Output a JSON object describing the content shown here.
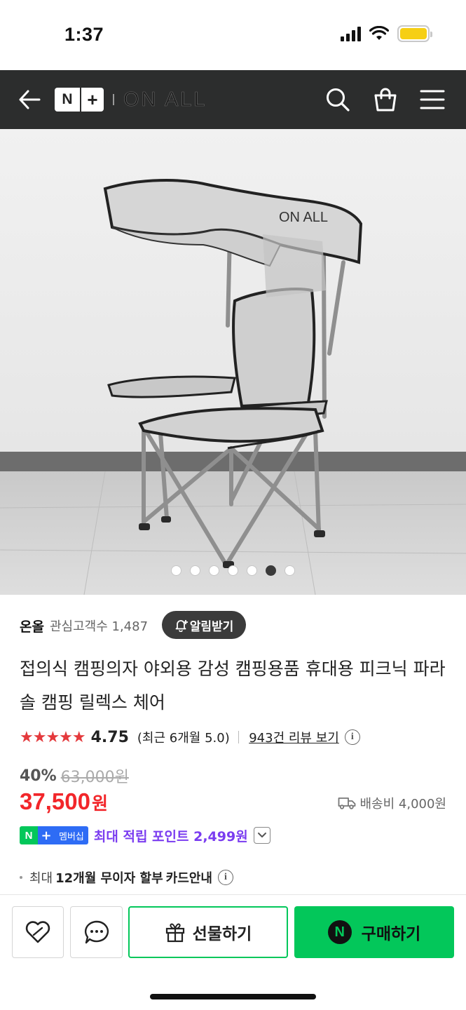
{
  "status_bar": {
    "time": "1:37"
  },
  "header": {
    "nplus_n": "N",
    "nplus_plus": "+",
    "brand": "ON ALL",
    "icons": [
      "back-arrow-icon",
      "search-icon",
      "shopping-bag-icon",
      "menu-icon"
    ]
  },
  "gallery": {
    "total": 7,
    "current": 6
  },
  "store": {
    "name": "온올",
    "followers": "관심고객수 1,487",
    "alarm_label": "알림받기"
  },
  "product": {
    "title": "접의식 캠핑의자 야외용 감성 캠핑용품 휴대용 피크닉 파라솔 캠핑 릴렉스 체어",
    "stars": "★★★★★",
    "rating": "4.75",
    "recent_rating": "(최근 6개월 5.0)",
    "review_link": "943건 리뷰 보기",
    "discount": "40%",
    "original_price": "63,000원",
    "price": "37,500",
    "currency": "원",
    "shipping": "배송비 4,000원",
    "member_badge_n": "N",
    "member_badge_plus": "+",
    "member_badge_text": "멤버십",
    "points": "최대 적립 포인트 2,499원",
    "installment_prefix": "최대",
    "installment_bold": "12개월 무이자 할부",
    "installment_suffix": "카드안내"
  },
  "bottom_bar": {
    "gift_label": "선물하기",
    "buy_label": "구매하기",
    "npay_letter": "N"
  },
  "colors": {
    "header_bg": "#2c2d2d",
    "price_red": "#f2262a",
    "naver_green": "#03c75a",
    "points_purple": "#7a3cf0",
    "star_red": "#e4393c"
  }
}
